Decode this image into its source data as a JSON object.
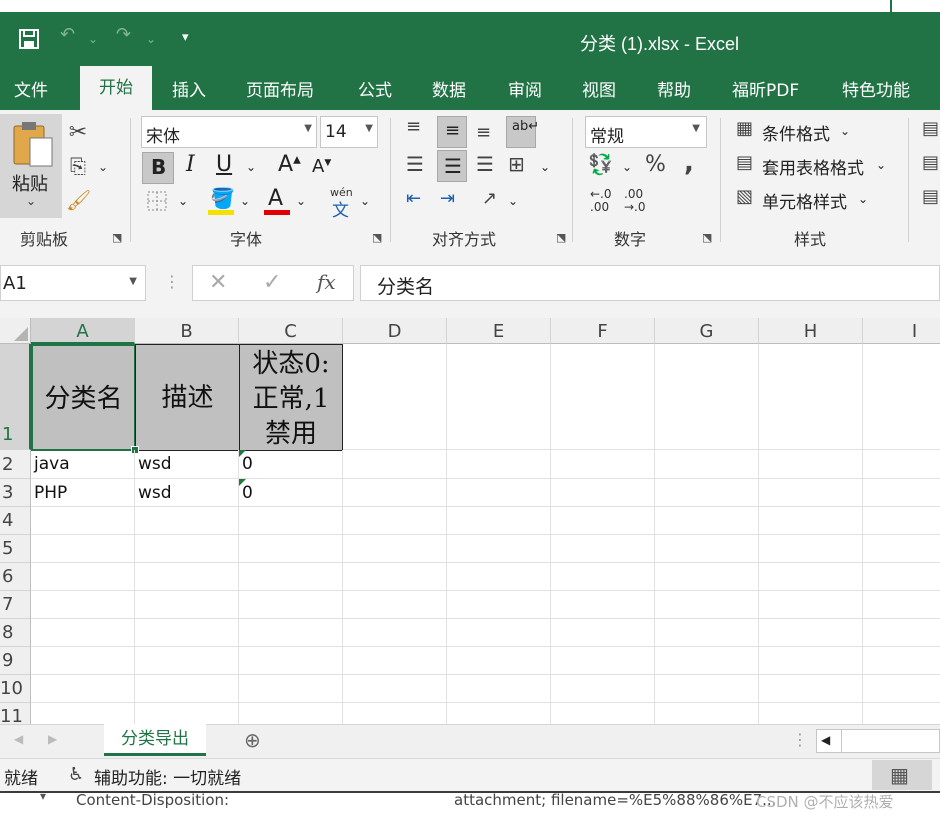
{
  "window": {
    "title": "分类 (1).xlsx  -  Excel"
  },
  "quick_access": {
    "save_icon": "save-icon",
    "undo_icon": "undo-icon",
    "redo_icon": "redo-icon",
    "customize_icon": "customize-icon"
  },
  "tabs": [
    "文件",
    "开始",
    "插入",
    "页面布局",
    "公式",
    "数据",
    "审阅",
    "视图",
    "帮助",
    "福昕PDF",
    "特色功能"
  ],
  "ribbon": {
    "clipboard": {
      "paste_label": "粘贴",
      "group_label": "剪贴板"
    },
    "font": {
      "name": "宋体",
      "size": "14",
      "group_label": "字体",
      "bold": "B",
      "italic": "I",
      "underline": "U",
      "phonetic": "wén"
    },
    "alignment": {
      "group_label": "对齐方式"
    },
    "number": {
      "format": "常规",
      "group_label": "数字",
      "percent": "%",
      "comma": ","
    },
    "styles": {
      "conditional": "条件格式",
      "table": "套用表格格式",
      "cell": "单元格样式",
      "group_label": "样式"
    },
    "colors": {
      "fill": "#f5e100",
      "font": "#e00000",
      "accent": "#217346"
    }
  },
  "formula_bar": {
    "name_box": "A1",
    "fx": "fx",
    "content": "分类名"
  },
  "grid": {
    "columns": [
      "A",
      "B",
      "C",
      "D",
      "E",
      "F",
      "G",
      "H",
      "I"
    ],
    "rows": [
      "1",
      "2",
      "3",
      "4",
      "5",
      "6",
      "7",
      "8",
      "9",
      "10",
      "11"
    ],
    "header_row": [
      "分类名",
      "描述",
      "状态0:正常,1禁用"
    ],
    "data": [
      [
        "java",
        "wsd",
        "0"
      ],
      [
        "PHP",
        "wsd",
        "0"
      ]
    ],
    "selected_cell": "A1"
  },
  "sheets": [
    "分类导出"
  ],
  "status": {
    "ready": "就绪",
    "accessibility": "辅助功能: 一切就绪"
  },
  "background_strip": {
    "left_text": "Content-Disposition:",
    "right_text": "attachment; filename=%E5%88%86%E7...",
    "watermark": "CSDN @不应该热爱"
  }
}
